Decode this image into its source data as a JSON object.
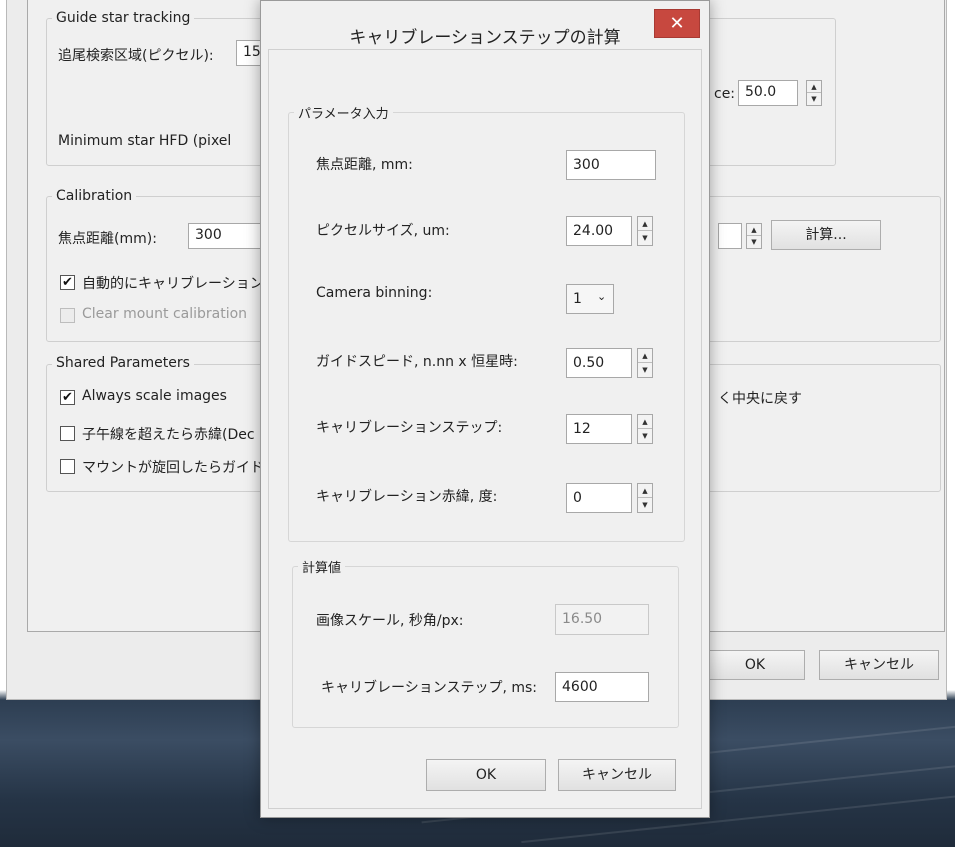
{
  "parent": {
    "guide_star": {
      "title": "Guide star tracking",
      "search_label": "追尾検索区域(ピクセル):",
      "search_value": "15",
      "right_label_fragment": "ce:",
      "right_value": "50.0",
      "min_hfd_label": "Minimum star HFD (pixel"
    },
    "calibration": {
      "title": "Calibration",
      "focal_label": "焦点距離(mm):",
      "focal_value": "300",
      "calc_button": "計算...",
      "auto_cal_label": "自動的にキャリブレーションを",
      "auto_cal_checked": true,
      "clear_mount_label": "Clear mount calibration"
    },
    "shared": {
      "title": "Shared Parameters",
      "always_scale_label": "Always scale images",
      "always_scale_checked": true,
      "meridian_label": "子午線を超えたら赤緯(Dec",
      "slew_label": "マウントが旋回したらガイド停",
      "right_fragment": "く中央に戻す"
    },
    "ok_button": "OK",
    "cancel_button": "キャンセル"
  },
  "dialog": {
    "title": "キャリブレーションステップの計算",
    "close_glyph": "✕",
    "params": {
      "title": "パラメータ入力",
      "focal_label": "焦点距離, mm:",
      "focal_value": "300",
      "pixel_label": "ピクセルサイズ, um:",
      "pixel_value": "24.00",
      "binning_label": "Camera binning:",
      "binning_value": "1",
      "guide_speed_label": "ガイドスピード, n.nn x 恒星時:",
      "guide_speed_value": "0.50",
      "cal_steps_label": "キャリブレーションステップ:",
      "cal_steps_value": "12",
      "cal_dec_label": "キャリブレーション赤緯, 度:",
      "cal_dec_value": "0"
    },
    "computed": {
      "title": "計算値",
      "scale_label": "画像スケール, 秒角/px:",
      "scale_value": "16.50",
      "step_label": "キャリブレーションステップ, ms:",
      "step_value": "4600"
    },
    "ok_button": "OK",
    "cancel_button": "キャンセル"
  },
  "colors": {
    "close_button": "#c7483f",
    "window_background": "#f0f0f0"
  }
}
